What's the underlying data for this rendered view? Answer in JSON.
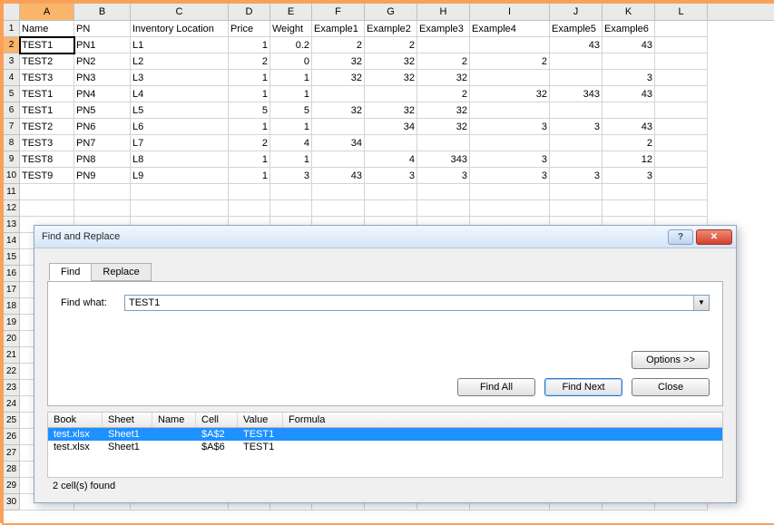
{
  "columns": [
    "A",
    "B",
    "C",
    "D",
    "E",
    "F",
    "G",
    "H",
    "I",
    "J",
    "K",
    "L"
  ],
  "headers": [
    "Name",
    "PN",
    "Inventory Location",
    "Price",
    "Weight",
    "Example1",
    "Example2",
    "Example3",
    "Example4",
    "Example5",
    "Example6"
  ],
  "chart_data": {
    "type": "table",
    "columns": [
      "Name",
      "PN",
      "Inventory Location",
      "Price",
      "Weight",
      "Example1",
      "Example2",
      "Example3",
      "Example4",
      "Example5",
      "Example6"
    ],
    "rows": [
      [
        "TEST1",
        "PN1",
        "L1",
        "1",
        "0.2",
        "2",
        "2",
        "",
        "",
        "43",
        "43"
      ],
      [
        "TEST2",
        "PN2",
        "L2",
        "2",
        "0",
        "32",
        "32",
        "2",
        "2",
        "",
        ""
      ],
      [
        "TEST3",
        "PN3",
        "L3",
        "1",
        "1",
        "32",
        "32",
        "32",
        "",
        "",
        "3"
      ],
      [
        "TEST1",
        "PN4",
        "L4",
        "1",
        "1",
        "",
        "",
        "2",
        "32",
        "343",
        "43"
      ],
      [
        "TEST1",
        "PN5",
        "L5",
        "5",
        "5",
        "32",
        "32",
        "32",
        "",
        "",
        ""
      ],
      [
        "TEST2",
        "PN6",
        "L6",
        "1",
        "1",
        "",
        "34",
        "32",
        "3",
        "3",
        "43"
      ],
      [
        "TEST3",
        "PN7",
        "L7",
        "2",
        "4",
        "34",
        "",
        "",
        "",
        "",
        "2"
      ],
      [
        "TEST8",
        "PN8",
        "L8",
        "1",
        "1",
        "",
        "4",
        "343",
        "3",
        "",
        "12"
      ],
      [
        "TEST9",
        "PN9",
        "L9",
        "1",
        "3",
        "43",
        "3",
        "3",
        "3",
        "3",
        "3"
      ]
    ]
  },
  "selected_cell": {
    "row": 0,
    "col": 0
  },
  "dialog": {
    "title": "Find and Replace",
    "tabs": {
      "find": "Find",
      "replace": "Replace"
    },
    "find_what_label": "Find what:",
    "find_what_value": "TEST1",
    "options_btn": "Options >>",
    "find_all_btn": "Find All",
    "find_next_btn": "Find Next",
    "close_btn": "Close",
    "result_headers": {
      "book": "Book",
      "sheet": "Sheet",
      "name": "Name",
      "cell": "Cell",
      "value": "Value",
      "formula": "Formula"
    },
    "results": [
      {
        "book": "test.xlsx",
        "sheet": "Sheet1",
        "name": "",
        "cell": "$A$2",
        "value": "TEST1",
        "formula": ""
      },
      {
        "book": "test.xlsx",
        "sheet": "Sheet1",
        "name": "",
        "cell": "$A$6",
        "value": "TEST1",
        "formula": ""
      }
    ],
    "status": "2 cell(s) found",
    "help_symbol": "?",
    "close_symbol": "✕",
    "drop_symbol": "▼"
  }
}
